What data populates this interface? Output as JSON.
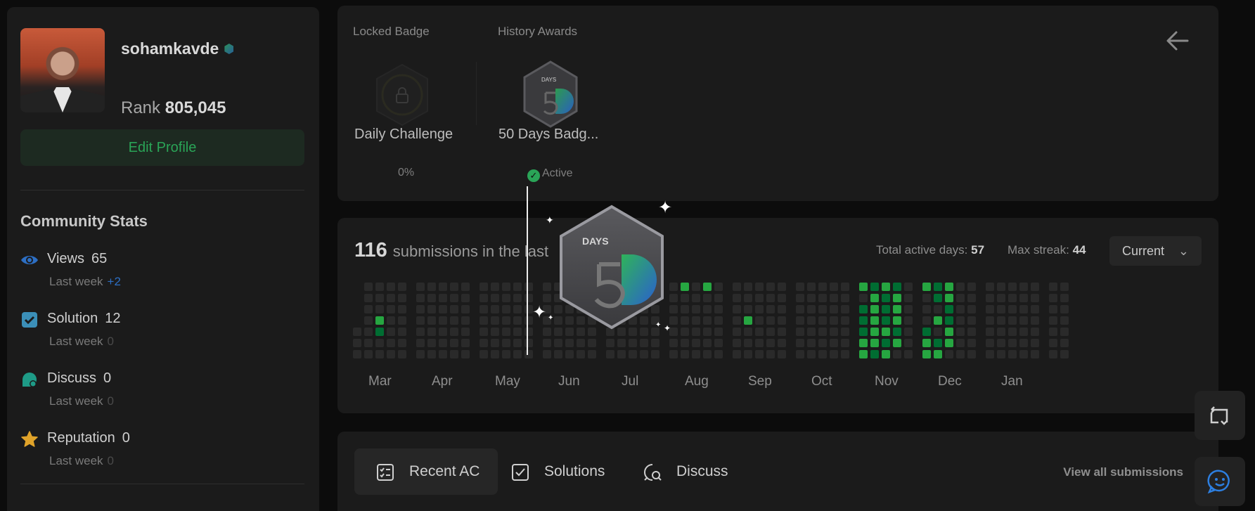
{
  "profile": {
    "username": "sohamkavde",
    "rank_label": "Rank",
    "rank_value": "805,045",
    "edit_button": "Edit Profile"
  },
  "community": {
    "title": "Community Stats",
    "stats": [
      {
        "icon": "eye-icon",
        "label": "Views",
        "value": "65",
        "sub": "Last week",
        "delta": "+2",
        "color": "#2d6fc4"
      },
      {
        "icon": "solution-check-icon",
        "label": "Solution",
        "value": "12",
        "sub": "Last week",
        "delta": "0",
        "color": "#3b8fb8"
      },
      {
        "icon": "discuss-bubble-icon",
        "label": "Discuss",
        "value": "0",
        "sub": "Last week",
        "delta": "0",
        "color": "#1e9b87"
      },
      {
        "icon": "star-icon",
        "label": "Reputation",
        "value": "0",
        "sub": "Last week",
        "delta": "0",
        "color": "#e0a32a"
      }
    ]
  },
  "badges": {
    "locked_label": "Locked Badge",
    "history_label": "History Awards",
    "locked": {
      "name": "Daily Challenge",
      "progress": "0%"
    },
    "history": {
      "name": "50 Days Badg...",
      "status": "Active",
      "badge_text": "DAYS"
    }
  },
  "submissions": {
    "count": "116",
    "title_text": "submissions in the last",
    "total_active_label": "Total active days:",
    "total_active_value": "57",
    "max_streak_label": "Max streak:",
    "max_streak_value": "44",
    "period": "Current",
    "months": [
      "Mar",
      "Apr",
      "May",
      "Jun",
      "Jul",
      "Aug",
      "Sep",
      "Oct",
      "Nov",
      "Dec",
      "Jan"
    ]
  },
  "tabs": {
    "items": [
      {
        "label": "Recent AC",
        "icon": "list-check-icon"
      },
      {
        "label": "Solutions",
        "icon": "checkbox-icon"
      },
      {
        "label": "Discuss",
        "icon": "discuss-search-icon"
      }
    ],
    "view_all": "View all submissions"
  },
  "colors": {
    "accent_green": "#2aa457",
    "cell_empty": "#2a2a2a",
    "cell_levels": [
      "#0e4429",
      "#006d32",
      "#26a641",
      "#39d353"
    ]
  }
}
